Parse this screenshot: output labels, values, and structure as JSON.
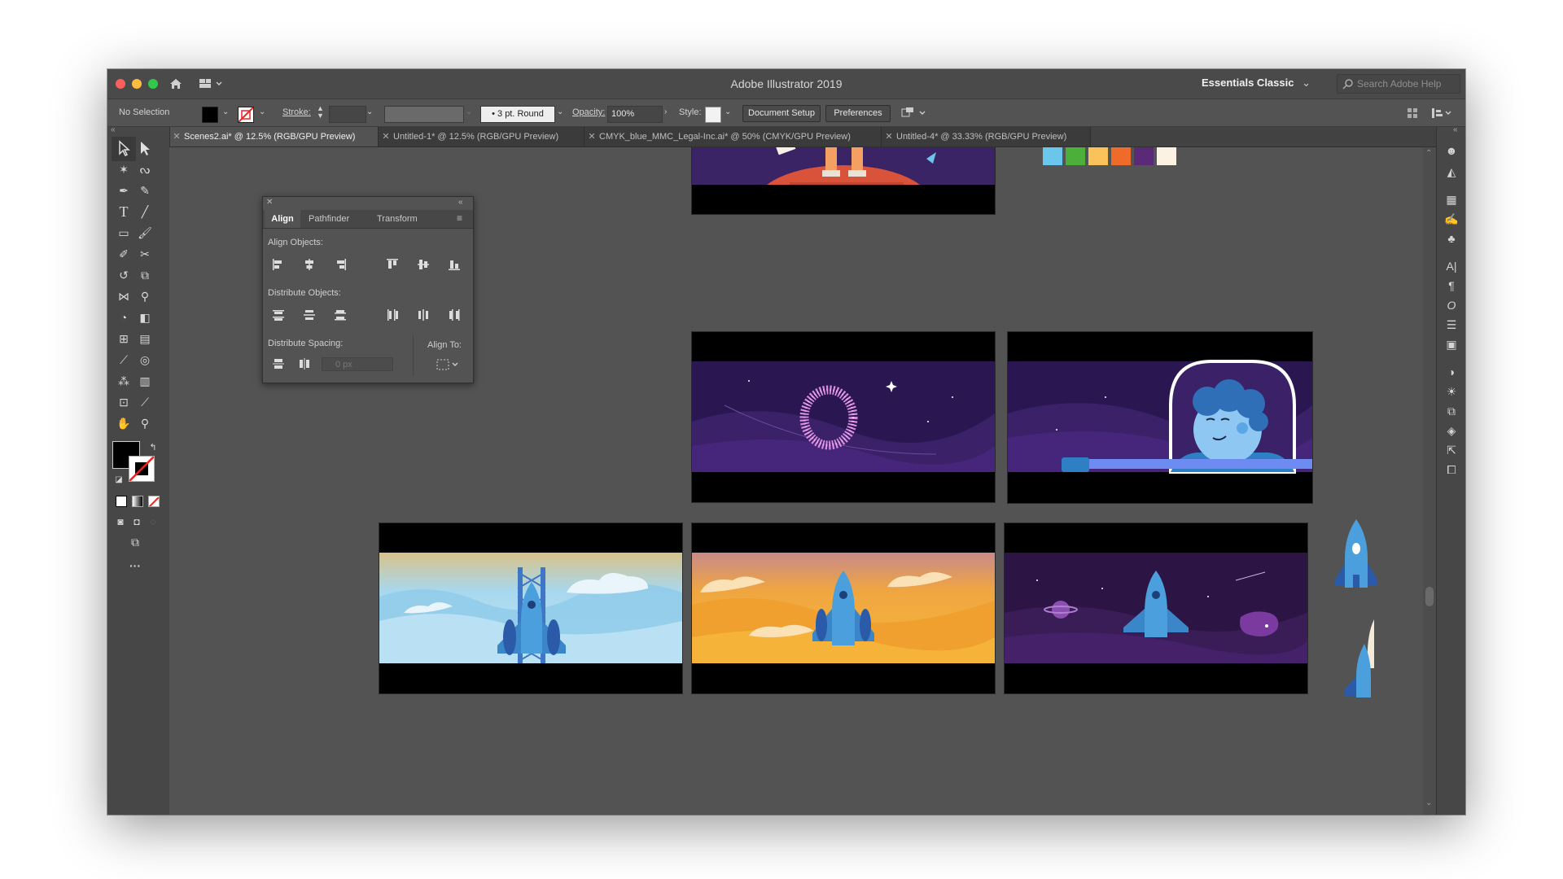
{
  "window": {
    "title": "Adobe Illustrator 2019",
    "workspace": "Essentials Classic",
    "search_placeholder": "Search Adobe Help"
  },
  "control_bar": {
    "selection": "No Selection",
    "stroke_label": "Stroke:",
    "brush": "3 pt. Round",
    "opacity_label": "Opacity:",
    "opacity_value": "100%",
    "style_label": "Style:",
    "document_setup": "Document Setup",
    "preferences": "Preferences"
  },
  "tabs": [
    {
      "label": "Scenes2.ai* @ 12.5% (RGB/GPU Preview)",
      "active": true
    },
    {
      "label": "Untitled-1* @ 12.5% (RGB/GPU Preview)",
      "active": false
    },
    {
      "label": "CMYK_blue_MMC_Legal-Inc.ai* @ 50% (CMYK/GPU Preview)",
      "active": false
    },
    {
      "label": "Untitled-4* @ 33.33% (RGB/GPU Preview)",
      "active": false
    }
  ],
  "align_panel": {
    "tabs": [
      "Align",
      "Pathfinder",
      "Transform"
    ],
    "align_objects": "Align Objects:",
    "distribute_objects": "Distribute Objects:",
    "distribute_spacing": "Distribute Spacing:",
    "align_to": "Align To:",
    "spacing_value": "0 px"
  },
  "swatches": [
    "#6bc6ec",
    "#4caf3a",
    "#f9c25a",
    "#ef6b2a",
    "#5a2a79",
    "#fbf2e4"
  ],
  "colors": {
    "window_bg": "#535353",
    "toolbar_bg": "#474747",
    "space_purple": "#3b2466",
    "sky_blue": "#9fd6ef",
    "sunset_orange": "#f3a533",
    "rocket_blue": "#4a9fdc"
  }
}
